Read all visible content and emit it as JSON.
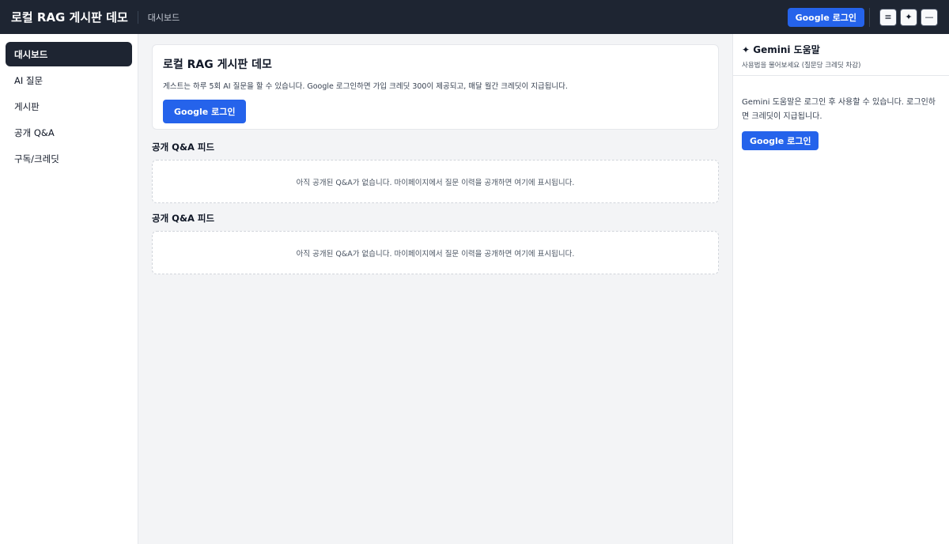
{
  "header": {
    "title": "로컬 RAG 게시판 데모",
    "breadcrumb": "대시보드",
    "login_label": "Google 로그인",
    "menu_icon": "≡",
    "sparkle_icon": "✦",
    "minimize_icon": "—"
  },
  "sidebar": {
    "items": [
      {
        "label": "대시보드",
        "active": true
      },
      {
        "label": "AI 질문"
      },
      {
        "label": "게시판"
      },
      {
        "label": "공개 Q&A"
      },
      {
        "label": "구독/크레딧"
      }
    ]
  },
  "main": {
    "hero_title": "로컬 RAG 게시판 데모",
    "hero_desc": "게스트는 하루 5회 AI 질문을 할 수 있습니다. Google 로그인하면 가입 크레딧 300이 제공되고, 매달 월간 크레딧이 지급됩니다.",
    "hero_button": "Google 로그인",
    "feeds": [
      {
        "title": "공개 Q&A 피드",
        "empty_text": "아직 공개된 Q&A가 없습니다. 마이페이지에서 질문 이력을 공개하면 여기에 표시됩니다."
      },
      {
        "title": "공개 Q&A 피드",
        "empty_text": "아직 공개된 Q&A가 없습니다. 마이페이지에서 질문 이력을 공개하면 여기에 표시됩니다."
      }
    ]
  },
  "gemini": {
    "title": "✦ Gemini 도움말",
    "subtitle": "사용법을 물어보세요 (질문당 크레딧 차감)",
    "message": "Gemini 도움말은 로그인 후 사용할 수 있습니다. 로그인하면 크레딧이 지급됩니다.",
    "button": "Google 로그인"
  },
  "colors": {
    "topbar": "#1e2532",
    "accent": "#2563eb",
    "active_nav": "#1e2532",
    "background": "#f3f4f6"
  }
}
